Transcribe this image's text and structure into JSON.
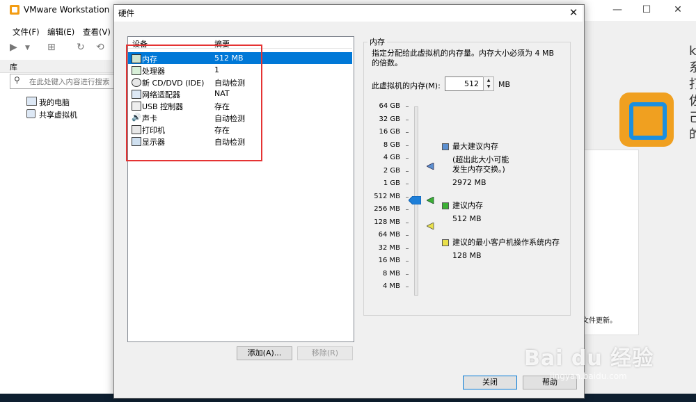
{
  "main": {
    "title": "VMware Workstation",
    "menu": [
      "文件(F)",
      "编辑(E)",
      "查看(V)"
    ],
    "library_title": "库",
    "search_placeholder": "在此处键入内容进行搜索",
    "tree": [
      "我的电脑",
      "共享虚拟机"
    ],
    "right_text": "文件更新。",
    "right_chars": [
      "k",
      "系",
      "打",
      "佐",
      "己",
      "的"
    ]
  },
  "dialog": {
    "title": "硬件",
    "columns": {
      "device": "设备",
      "summary": "摘要"
    },
    "devices": [
      {
        "name": "内存",
        "summary": "512 MB",
        "icon": "memory-icon",
        "selected": true
      },
      {
        "name": "处理器",
        "summary": "1",
        "icon": "processor-icon"
      },
      {
        "name": "新 CD/DVD (IDE)",
        "summary": "自动检测",
        "icon": "cd-dvd-icon"
      },
      {
        "name": "网络适配器",
        "summary": "NAT",
        "icon": "network-adapter-icon"
      },
      {
        "name": "USB 控制器",
        "summary": "存在",
        "icon": "usb-icon"
      },
      {
        "name": "声卡",
        "summary": "自动检测",
        "icon": "sound-card-icon"
      },
      {
        "name": "打印机",
        "summary": "存在",
        "icon": "printer-icon"
      },
      {
        "name": "显示器",
        "summary": "自动检测",
        "icon": "display-icon"
      }
    ],
    "buttons": {
      "add": "添加(A)...",
      "remove": "移除(R)",
      "close": "关闭",
      "help": "帮助"
    }
  },
  "memory": {
    "group_title": "内存",
    "description": "指定分配给此虚拟机的内存量。内存大小必须为 4 MB 的倍数。",
    "field_label": "此虚拟机的内存(M):",
    "value": "512",
    "unit": "MB",
    "scale": [
      "64 GB",
      "32 GB",
      "16 GB",
      "8 GB",
      "4 GB",
      "2 GB",
      "1 GB",
      "512 MB",
      "256 MB",
      "128 MB",
      "64 MB",
      "32 MB",
      "16 MB",
      "8 MB",
      "4 MB"
    ],
    "max_recommended": {
      "label": "最大建议内存",
      "note1": "(超出此大小可能",
      "note2": "发生内存交换。)",
      "value": "2972 MB",
      "color": "#5b8fd0"
    },
    "recommended": {
      "label": "建议内存",
      "value": "512 MB",
      "color": "#3cb034"
    },
    "min_os": {
      "label": "建议的最小客户机操作系统内存",
      "value": "128 MB",
      "color": "#e9e04a"
    },
    "slider_color": "#1e7fd8"
  },
  "watermark": {
    "text": "Bai du 经验",
    "url": "jingyan.baidu.com"
  }
}
